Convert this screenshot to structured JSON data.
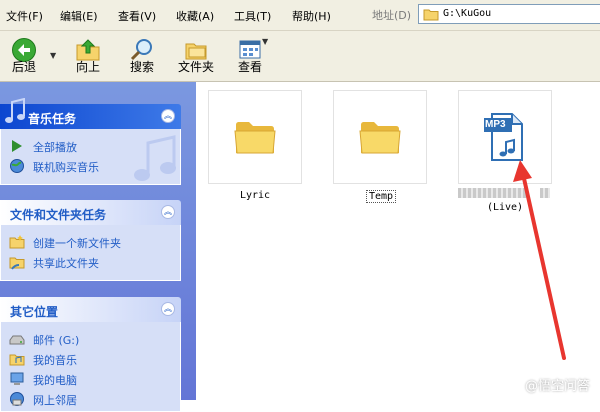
{
  "menubar": {
    "items": [
      "文件(F)",
      "编辑(E)",
      "查看(V)",
      "收藏(A)",
      "工具(T)",
      "帮助(H)"
    ],
    "address_label": "地址(D)",
    "address_value": "G:\\KuGou"
  },
  "toolbar": {
    "back": "后退",
    "up": "向上",
    "search": "搜索",
    "folders": "文件夹",
    "view": "查看"
  },
  "panels": {
    "music": {
      "title": "音乐任务",
      "items": [
        "全部播放",
        "联机购买音乐"
      ]
    },
    "file_tasks": {
      "title": "文件和文件夹任务",
      "items": [
        "创建一个新文件夹",
        "共享此文件夹"
      ]
    },
    "other_places": {
      "title": "其它位置",
      "items": [
        "邮件 (G:)",
        "我的音乐",
        "我的电脑",
        "网上邻居"
      ]
    }
  },
  "files": [
    {
      "name": "Lyric",
      "icon": "folder-icon"
    },
    {
      "name": "Temp",
      "icon": "folder-icon"
    },
    {
      "name_suffix": "(Live)",
      "icon": "mp3-file-icon",
      "badge": "MP3"
    }
  ],
  "watermark": "@悟空问答",
  "colors": {
    "arrow": "#e8362f",
    "accent_blue": "#215dc6",
    "mp3_blue": "#2f6fb4"
  }
}
